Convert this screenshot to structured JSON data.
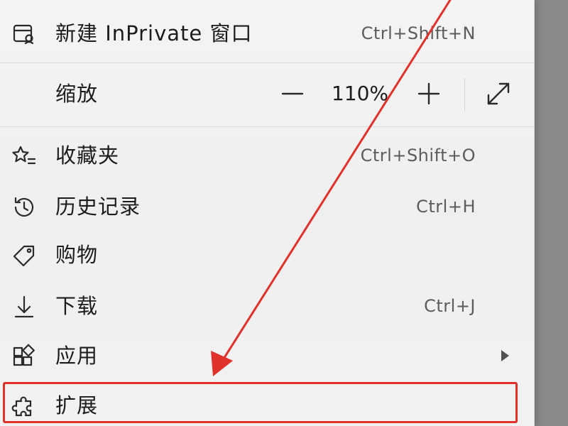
{
  "menu": {
    "inprivate": {
      "label": "新建 InPrivate 窗口",
      "shortcut": "Ctrl+Shift+N",
      "icon": "inprivate-window-icon"
    },
    "zoom": {
      "label": "缩放",
      "value": "110%",
      "decrease_icon": "minus-icon",
      "increase_icon": "plus-icon",
      "fullscreen_icon": "fullscreen-icon"
    },
    "favorites": {
      "label": "收藏夹",
      "shortcut": "Ctrl+Shift+O",
      "icon": "star-list-icon"
    },
    "history": {
      "label": "历史记录",
      "shortcut": "Ctrl+H",
      "icon": "history-icon"
    },
    "shopping": {
      "label": "购物",
      "icon": "tag-icon"
    },
    "downloads": {
      "label": "下载",
      "shortcut": "Ctrl+J",
      "icon": "download-icon"
    },
    "apps": {
      "label": "应用",
      "icon": "apps-icon",
      "has_submenu": true
    },
    "extensions": {
      "label": "扩展",
      "icon": "puzzle-icon",
      "highlighted": true
    }
  },
  "annotation": {
    "color": "#e0322a",
    "type": "arrow-pointing-to-extensions"
  }
}
